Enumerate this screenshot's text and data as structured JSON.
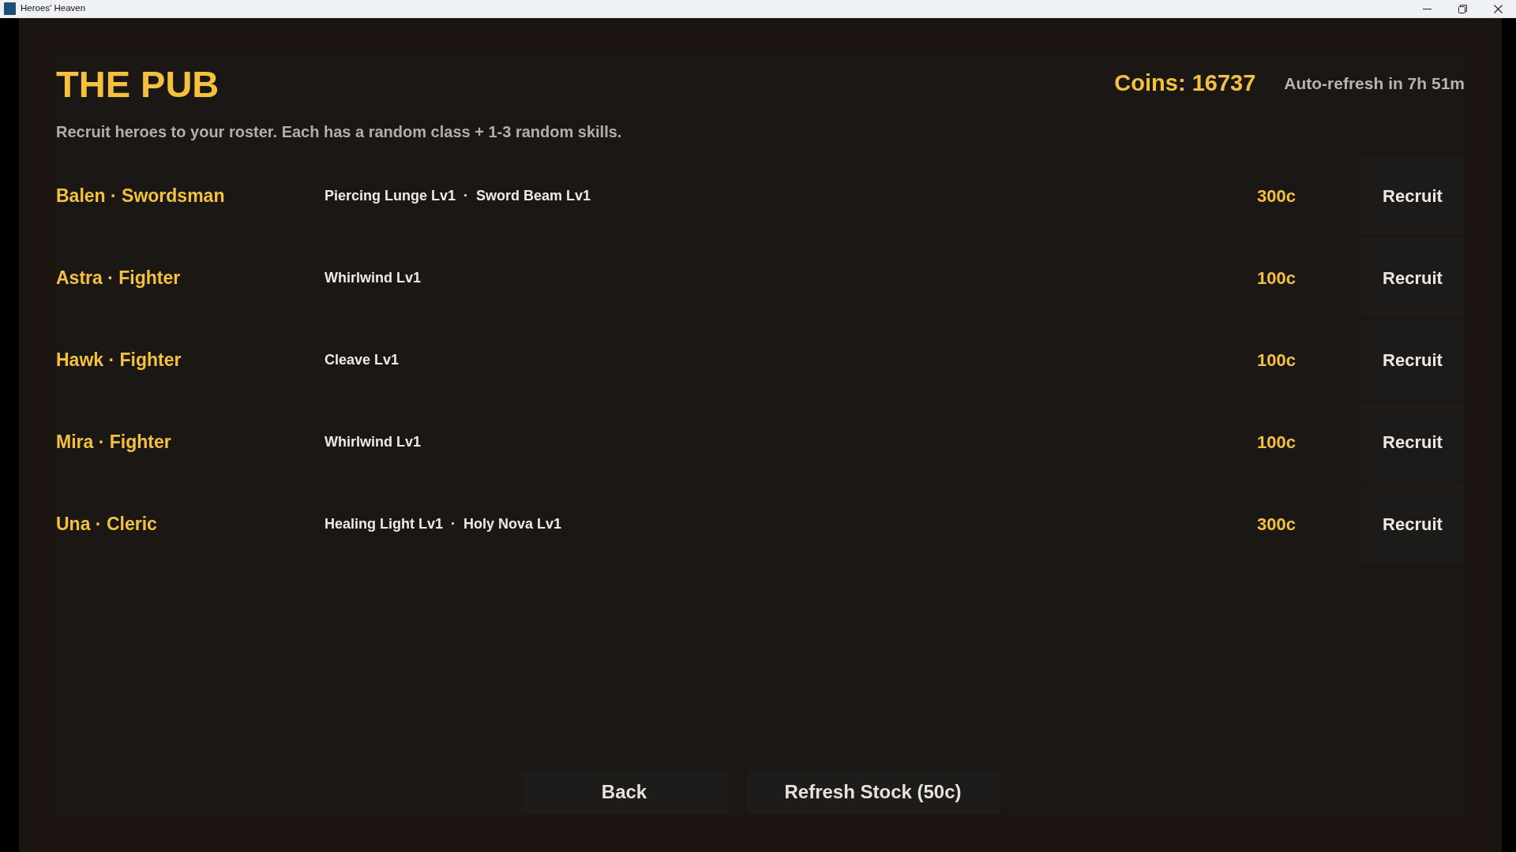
{
  "window": {
    "title": "Heroes' Heaven"
  },
  "header": {
    "title": "THE PUB",
    "coins": "Coins: 16737",
    "auto_refresh": "Auto-refresh in 7h 51m",
    "subtitle": "Recruit heroes to your roster. Each has a random class + 1-3 random skills."
  },
  "heroes": [
    {
      "name": "Balen · Swordsman",
      "skills": "Piercing Lunge Lv1  ·  Sword Beam Lv1",
      "price": "300c",
      "button": "Recruit"
    },
    {
      "name": "Astra · Fighter",
      "skills": "Whirlwind Lv1",
      "price": "100c",
      "button": "Recruit"
    },
    {
      "name": "Hawk · Fighter",
      "skills": "Cleave Lv1",
      "price": "100c",
      "button": "Recruit"
    },
    {
      "name": "Mira · Fighter",
      "skills": "Whirlwind Lv1",
      "price": "100c",
      "button": "Recruit"
    },
    {
      "name": "Una · Cleric",
      "skills": "Healing Light Lv1  ·  Holy Nova Lv1",
      "price": "300c",
      "button": "Recruit"
    }
  ],
  "footer_buttons": [
    {
      "kind": "back",
      "label": "Back"
    },
    {
      "kind": "refresh",
      "label": "Refresh Stock (50c)"
    }
  ]
}
